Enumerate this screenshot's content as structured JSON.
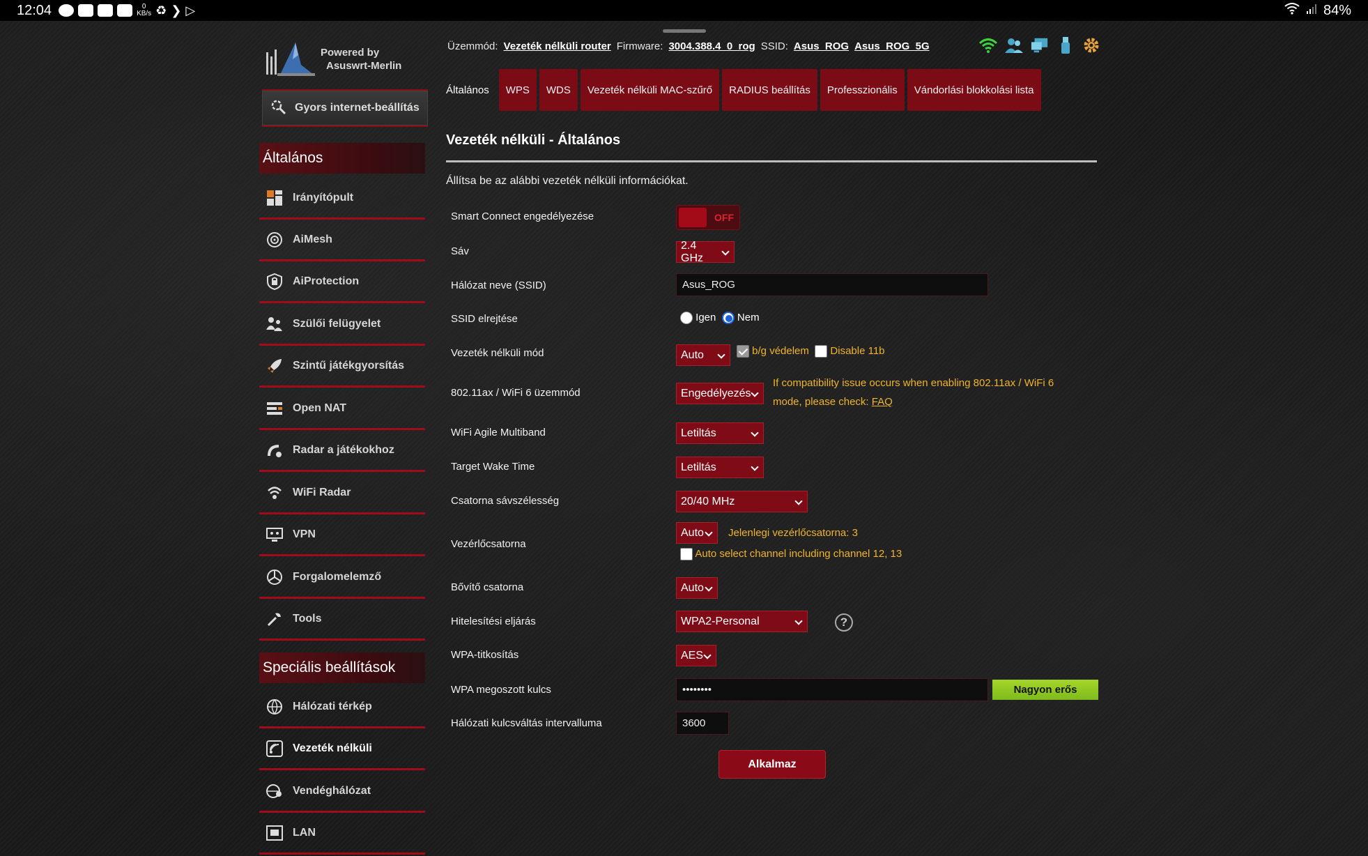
{
  "status_bar": {
    "time": "12:04",
    "net_speed": "0",
    "net_unit": "KB/s",
    "battery": "84%"
  },
  "logo": {
    "line1": "Powered by",
    "line2": "Asuswrt-Merlin"
  },
  "quick_setup": "Gyors internet-beállítás",
  "sidebar": {
    "section_general": "Általános",
    "general_items": [
      {
        "label": "Irányítópult",
        "icon": "dashboard-icon"
      },
      {
        "label": "AiMesh",
        "icon": "aimesh-icon"
      },
      {
        "label": "AiProtection",
        "icon": "shield-icon"
      },
      {
        "label": "Szülői felügyelet",
        "icon": "parental-icon"
      },
      {
        "label": "Szintű játékgyorsítás",
        "icon": "rocket-icon"
      },
      {
        "label": "Open NAT",
        "icon": "open-nat-icon"
      },
      {
        "label": "Radar a játékokhoz",
        "icon": "game-radar-icon"
      },
      {
        "label": "WiFi Radar",
        "icon": "wifi-radar-icon"
      },
      {
        "label": "VPN",
        "icon": "vpn-icon"
      },
      {
        "label": "Forgalomelemző",
        "icon": "traffic-icon"
      },
      {
        "label": "Tools",
        "icon": "tools-icon"
      }
    ],
    "section_advanced": "Speciális beállítások",
    "advanced_items": [
      {
        "label": "Hálózati térkép",
        "icon": "network-map-icon"
      },
      {
        "label": "Vezeték nélküli",
        "icon": "wireless-icon",
        "active": true
      },
      {
        "label": "Vendéghálózat",
        "icon": "guest-network-icon"
      },
      {
        "label": "LAN",
        "icon": "lan-icon"
      }
    ]
  },
  "topbar": {
    "mode_label": "Üzemmód:",
    "mode_value": "Vezeték nélküli router",
    "firmware_label": "Firmware:",
    "firmware_value": "3004.388.4_0_rog",
    "ssid_label": "SSID:",
    "ssid1": "Asus_ROG",
    "ssid2": "Asus_ROG_5G"
  },
  "tabs": [
    {
      "label": "Általános",
      "active": true
    },
    {
      "label": "WPS"
    },
    {
      "label": "WDS"
    },
    {
      "label": "Vezeték nélküli MAC-szűrő"
    },
    {
      "label": "RADIUS beállítás"
    },
    {
      "label": "Professzionális"
    },
    {
      "label": "Vándorlási blokkolási lista"
    }
  ],
  "page": {
    "title": "Vezeték nélküli - Általános",
    "intro": "Állítsa be az alábbi vezeték nélküli információkat."
  },
  "form": {
    "smart_connect_label": "Smart Connect engedélyezése",
    "smart_connect_state": "OFF",
    "band_label": "Sáv",
    "band_value": "2.4 GHz",
    "ssid_label": "Hálózat neve (SSID)",
    "ssid_value": "Asus_ROG",
    "hide_ssid_label": "SSID elrejtése",
    "hide_yes": "Igen",
    "hide_no": "Nem",
    "wireless_mode_label": "Vezeték nélküli mód",
    "wireless_mode_value": "Auto",
    "bg_protection": "b/g védelem",
    "disable_11b": "Disable 11b",
    "ax_label": "802.11ax / WiFi 6 üzemmód",
    "ax_value": "Engedélyezés",
    "ax_note": "If compatibility issue occurs when enabling 802.11ax / WiFi 6 mode, please check:",
    "ax_faq": "FAQ",
    "agile_label": "WiFi Agile Multiband",
    "agile_value": "Letiltás",
    "twt_label": "Target Wake Time",
    "twt_value": "Letiltás",
    "bandwidth_label": "Csatorna sávszélesség",
    "bandwidth_value": "20/40 MHz",
    "control_channel_label": "Vezérlőcsatorna",
    "control_channel_value": "Auto",
    "current_channel": "Jelenlegi vezérlőcsatorna: 3",
    "auto_channel_note": "Auto select channel including channel 12, 13",
    "ext_channel_label": "Bővítő csatorna",
    "ext_channel_value": "Auto",
    "auth_label": "Hitelesítési eljárás",
    "auth_value": "WPA2-Personal",
    "wpa_enc_label": "WPA-titkosítás",
    "wpa_enc_value": "AES",
    "psk_label": "WPA megoszott kulcs",
    "psk_value": "••••••••",
    "psk_strength": "Nagyon erős",
    "rekey_label": "Hálózati kulcsváltás intervalluma",
    "rekey_value": "3600",
    "apply": "Alkalmaz"
  },
  "colors": {
    "accent": "#8a0b17",
    "warning": "#f0b42a",
    "strength": "#8fc722"
  }
}
